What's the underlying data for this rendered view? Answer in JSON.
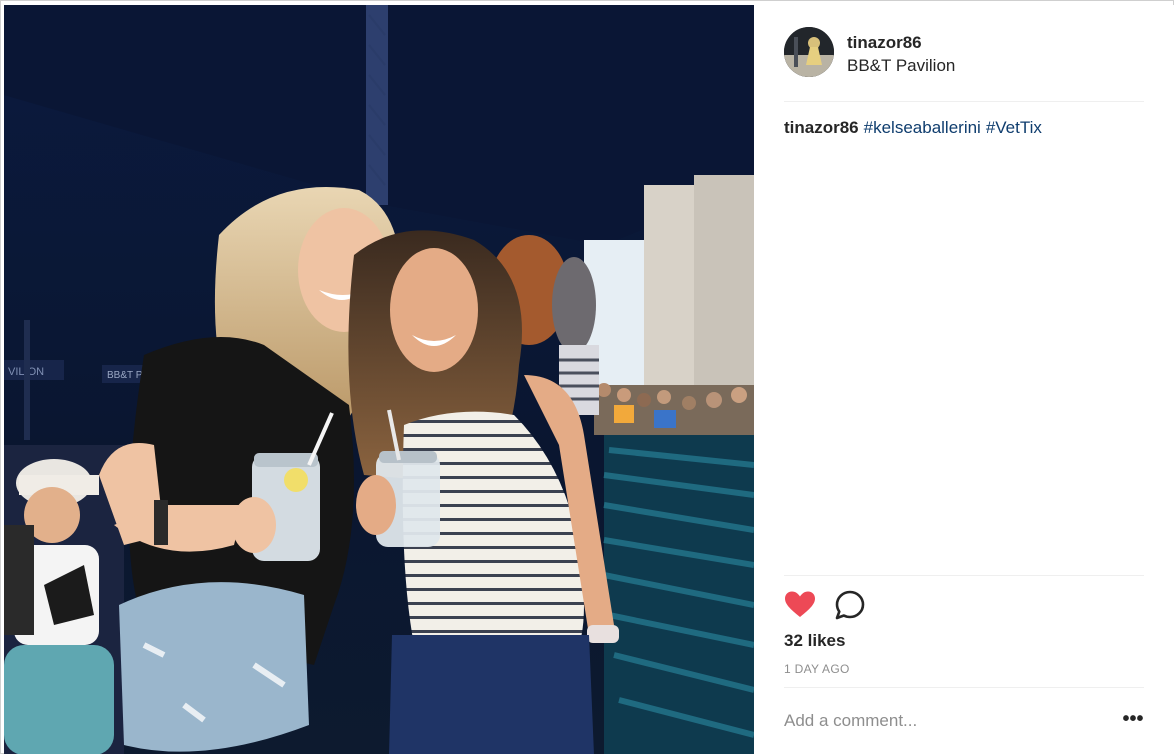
{
  "post": {
    "username": "tinazor86",
    "location": "BB&T Pavilion",
    "caption": {
      "username": "tinazor86",
      "hashtags": [
        "#kelseaballerini",
        "#VetTix"
      ]
    },
    "likes": "32 likes",
    "time_ago": "1 DAY AGO",
    "comment_placeholder": "Add a comment...",
    "more_label": "•••"
  },
  "photo": {
    "venue_sign": "BB&T PAV",
    "venue_sign_left": "VILION"
  },
  "icons": {
    "like": "heart-icon",
    "comment": "speech-bubble-icon",
    "more": "ellipsis-icon"
  },
  "colors": {
    "like_red": "#ed4956",
    "hashtag_blue": "#0f3d6e",
    "muted_gray": "#8e8e8e"
  }
}
